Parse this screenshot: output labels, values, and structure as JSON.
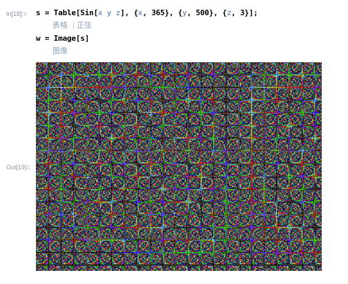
{
  "in_cell": {
    "label": "In[18]:=",
    "line1": {
      "lhs": "s",
      "eq": " = ",
      "func": "Table",
      "open": "[",
      "inner_func": "Sin",
      "inner_open": "[",
      "arg_x": "x",
      "arg_y": "y",
      "arg_z": "z",
      "inner_close": "], ",
      "iter1_open": "{",
      "iter1_var": "x",
      "iter1_rest": ", 365}, ",
      "iter2_open": "{",
      "iter2_var": "y",
      "iter2_rest": ", 500}, ",
      "iter3_open": "{",
      "iter3_var": "z",
      "iter3_rest": ", 3}];"
    },
    "line1_hints": [
      "表格",
      "正弦"
    ],
    "line2": {
      "lhs": "w",
      "eq": " = ",
      "func": "Image",
      "open": "[",
      "arg": "s",
      "close": "]"
    },
    "line2_hints": [
      "图像"
    ]
  },
  "out_cell": {
    "label": "Out[19]="
  },
  "colors": {
    "label": "#8a97a8",
    "hint": "#8ea4bf",
    "variable": "#4a6fa5"
  }
}
